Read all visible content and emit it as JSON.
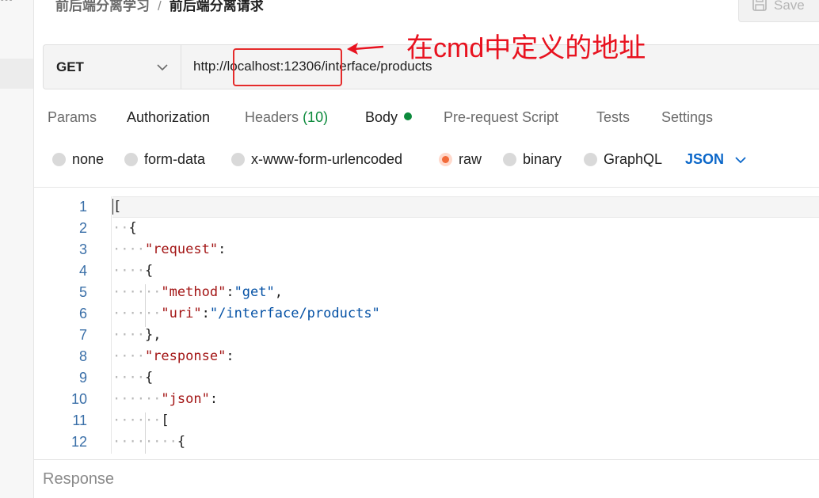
{
  "header": {
    "breadcrumb_parent": "前后端分离学习",
    "breadcrumb_separator": "/",
    "breadcrumb_current": "前后端分离请求",
    "save_label": "Save",
    "sidebar_snippet": "000"
  },
  "request": {
    "method": "GET",
    "url": "http://localhost:12306/interface/products"
  },
  "annotation": {
    "text": "在cmd中定义的地址",
    "color": "#e8121f"
  },
  "tabs": {
    "params": "Params",
    "authorization": "Authorization",
    "headers": "Headers",
    "headers_count": "(10)",
    "body": "Body",
    "prerequest": "Pre-request Script",
    "tests": "Tests",
    "settings": "Settings"
  },
  "body_types": {
    "none": "none",
    "form_data": "form-data",
    "urlencoded": "x-www-form-urlencoded",
    "raw": "raw",
    "binary": "binary",
    "graphql": "GraphQL",
    "language": "JSON",
    "selected": "raw"
  },
  "editor": {
    "line_numbers": [
      "1",
      "2",
      "3",
      "4",
      "5",
      "6",
      "7",
      "8",
      "9",
      "10",
      "11",
      "12"
    ],
    "lines": [
      {
        "indent": "",
        "parts": [
          [
            "p",
            "["
          ]
        ]
      },
      {
        "indent": "··",
        "parts": [
          [
            "p",
            "{"
          ]
        ]
      },
      {
        "indent": "····",
        "parts": [
          [
            "k",
            "\"request\""
          ],
          [
            "p",
            ":"
          ]
        ]
      },
      {
        "indent": "····",
        "parts": [
          [
            "p",
            "{"
          ]
        ]
      },
      {
        "indent": "······",
        "parts": [
          [
            "k",
            "\"method\""
          ],
          [
            "p",
            ":"
          ],
          [
            "s",
            "\"get\""
          ],
          [
            "p",
            ","
          ]
        ]
      },
      {
        "indent": "······",
        "parts": [
          [
            "k",
            "\"uri\""
          ],
          [
            "p",
            ":"
          ],
          [
            "s",
            "\"/interface/products\""
          ]
        ]
      },
      {
        "indent": "····",
        "parts": [
          [
            "p",
            "},"
          ]
        ]
      },
      {
        "indent": "····",
        "parts": [
          [
            "k",
            "\"response\""
          ],
          [
            "p",
            ":"
          ]
        ]
      },
      {
        "indent": "····",
        "parts": [
          [
            "p",
            "{"
          ]
        ]
      },
      {
        "indent": "······",
        "parts": [
          [
            "k",
            "\"json\""
          ],
          [
            "p",
            ":"
          ]
        ]
      },
      {
        "indent": "······",
        "parts": [
          [
            "p",
            "["
          ]
        ]
      },
      {
        "indent": "········",
        "parts": [
          [
            "p",
            "{"
          ]
        ]
      }
    ]
  },
  "footer": {
    "response_label": "Response"
  },
  "colors": {
    "accent_green": "#0c8a3c",
    "radio_selected": "#f26b3a",
    "language_blue": "#0b67c9",
    "highlight_red": "#e52b2b"
  }
}
